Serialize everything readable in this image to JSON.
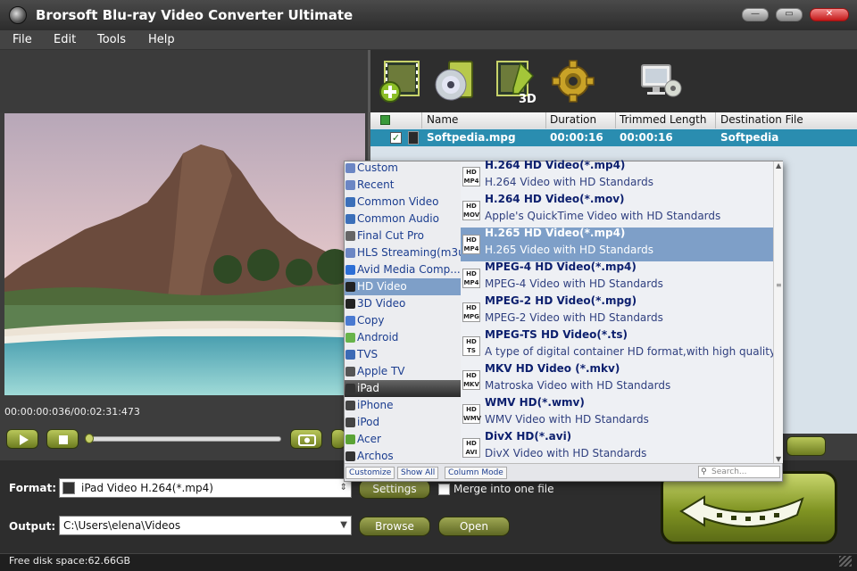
{
  "window": {
    "title": "Brorsoft Blu-ray Video Converter Ultimate",
    "controls": [
      "—",
      "▭",
      "✕"
    ]
  },
  "menu": [
    "File",
    "Edit",
    "Tools",
    "Help"
  ],
  "toolbar": [
    "add-video-icon",
    "load-disc-icon",
    "edit-3d-icon",
    "settings-gear-icon",
    "monitor-disc-icon"
  ],
  "preview": {
    "timecode": "00:00:00:036/00:02:31:473"
  },
  "filelist": {
    "columns": [
      "Name",
      "Duration",
      "Trimmed Length",
      "Destination File"
    ],
    "rows": [
      {
        "name": "Softpedia.mpg",
        "duration": "00:00:16",
        "trimmed": "00:00:16",
        "destination": "Softpedia"
      }
    ]
  },
  "categories": [
    {
      "label": "Custom",
      "color": "#6b86c4"
    },
    {
      "label": "Recent",
      "color": "#6b86c4"
    },
    {
      "label": "Common Video",
      "color": "#3b6fb9"
    },
    {
      "label": "Common Audio",
      "color": "#3b6fb9"
    },
    {
      "label": "Final Cut Pro",
      "color": "#666"
    },
    {
      "label": "HLS Streaming(m3u...",
      "color": "#6b86c4"
    },
    {
      "label": "Avid Media Comp...",
      "color": "#2d6fd6"
    },
    {
      "label": "HD Video",
      "color": "#222"
    },
    {
      "label": "3D Video",
      "color": "#222"
    },
    {
      "label": "Copy",
      "color": "#4a7ad1"
    },
    {
      "label": "Android",
      "color": "#67b34a"
    },
    {
      "label": "TVS",
      "color": "#3c6ab5"
    },
    {
      "label": "Apple TV",
      "color": "#555"
    },
    {
      "label": "iPad",
      "color": "#333"
    },
    {
      "label": "iPhone",
      "color": "#444"
    },
    {
      "label": "iPod",
      "color": "#444"
    },
    {
      "label": "Acer",
      "color": "#5aa335"
    },
    {
      "label": "Archos",
      "color": "#333"
    }
  ],
  "selected_category": "HD Video",
  "formats": [
    {
      "icon": "HD MP4",
      "name": "H.264 HD Video(*.mp4)",
      "desc": "H.264 Video with HD Standards"
    },
    {
      "icon": "HD MOV",
      "name": "H.264 HD Video(*.mov)",
      "desc": "Apple's QuickTime Video with HD Standards"
    },
    {
      "icon": "HD MP4",
      "name": "H.265 HD Video(*.mp4)",
      "desc": "H.265 Video with HD Standards"
    },
    {
      "icon": "HD MP4",
      "name": "MPEG-4 HD Video(*.mp4)",
      "desc": "MPEG-4 Video with HD Standards"
    },
    {
      "icon": "HD MPG",
      "name": "MPEG-2 HD Video(*.mpg)",
      "desc": "MPEG-2 Video with HD Standards"
    },
    {
      "icon": "HD TS",
      "name": "MPEG-TS HD Video(*.ts)",
      "desc": "A type of digital container HD format,with high quality"
    },
    {
      "icon": "HD MKV",
      "name": "MKV HD Video (*.mkv)",
      "desc": "Matroska Video with HD Standards"
    },
    {
      "icon": "HD WMV",
      "name": "WMV HD(*.wmv)",
      "desc": "WMV Video with HD Standards"
    },
    {
      "icon": "HD AVI",
      "name": "DivX HD(*.avi)",
      "desc": "DivX Video with HD Standards"
    }
  ],
  "selected_format": "H.265 HD Video(*.mp4)",
  "dropdown_footer": {
    "customize": "Customize",
    "show_all": "Show All",
    "column_mode": "Column Mode",
    "search_placeholder": "Search..."
  },
  "bottom": {
    "format_label": "Format:",
    "format_value": "iPad Video H.264(*.mp4)",
    "settings": "Settings",
    "merge_label": "Merge into one file",
    "output_label": "Output:",
    "output_value": "C:\\Users\\elena\\Videos",
    "browse": "Browse",
    "open": "Open"
  },
  "status": {
    "disk_space": "Free disk space:62.66GB"
  }
}
